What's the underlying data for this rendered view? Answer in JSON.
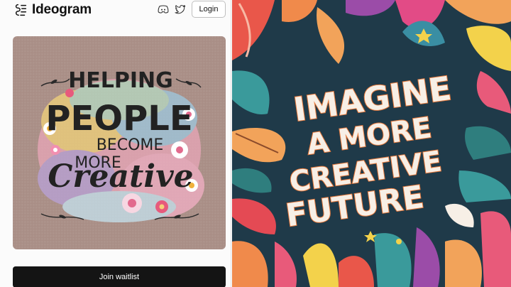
{
  "header": {
    "brand": "Ideogram",
    "login_label": "Login"
  },
  "left_card": {
    "lines": [
      "HELPING",
      "PEOPLE",
      "BECOME",
      "MORE",
      "Creative"
    ]
  },
  "cta": {
    "waitlist_label": "Join waitlist"
  },
  "right_art": {
    "lines": [
      "IMAGINE",
      "A MORE",
      "CREATIVE",
      "FUTURE"
    ]
  },
  "colors": {
    "card_bg": "#a98e86",
    "right_bg": "#1f3a49",
    "button_bg": "#141414"
  }
}
